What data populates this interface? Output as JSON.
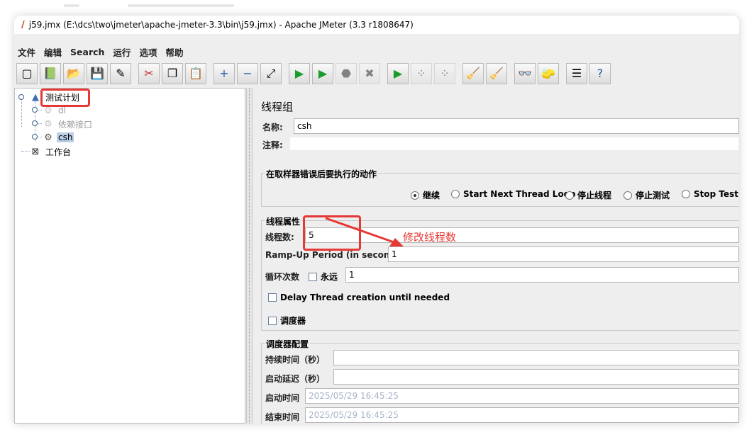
{
  "window": {
    "title": "j59.jmx (E:\\dcs\\two\\jmeter\\apache-jmeter-3.3\\bin\\j59.jmx) - Apache JMeter (3.3 r1808647)"
  },
  "menu": [
    "文件",
    "编辑",
    "Search",
    "运行",
    "选项",
    "帮助"
  ],
  "toolbar": [
    {
      "name": "new-icon",
      "glyph": "▢"
    },
    {
      "name": "templates-icon",
      "glyph": "📗"
    },
    {
      "name": "open-icon",
      "glyph": "📂"
    },
    {
      "name": "save-icon",
      "glyph": "💾"
    },
    {
      "name": "save-as-icon",
      "glyph": "✎"
    },
    {
      "name": "cut-icon",
      "glyph": "✂"
    },
    {
      "name": "copy-icon",
      "glyph": "❐"
    },
    {
      "name": "paste-icon",
      "glyph": "📋"
    },
    {
      "name": "expand-icon",
      "glyph": "+"
    },
    {
      "name": "collapse-icon",
      "glyph": "−"
    },
    {
      "name": "toggle-icon",
      "glyph": "⤢"
    },
    {
      "name": "start-icon",
      "glyph": "▶"
    },
    {
      "name": "start-no-pause-icon",
      "glyph": "▶"
    },
    {
      "name": "stop-icon",
      "glyph": "⬣"
    },
    {
      "name": "shutdown-icon",
      "glyph": "✖"
    },
    {
      "name": "remote-start-icon",
      "glyph": "▶"
    },
    {
      "name": "remote-stop-icon",
      "glyph": "⁘"
    },
    {
      "name": "remote-shutdown-icon",
      "glyph": "⁘"
    },
    {
      "name": "clear-icon",
      "glyph": "🧹"
    },
    {
      "name": "clear-all-icon",
      "glyph": "🧹"
    },
    {
      "name": "search-icon",
      "glyph": "👓"
    },
    {
      "name": "reset-search-icon",
      "glyph": "🧽"
    },
    {
      "name": "function-helper-icon",
      "glyph": "☰"
    },
    {
      "name": "help-icon",
      "glyph": "?"
    }
  ],
  "tree": {
    "root": "测试计划",
    "children": [
      "dl",
      "依赖接口",
      "csh"
    ],
    "workbench": "工作台"
  },
  "panel": {
    "heading": "线程组",
    "name_label": "名称:",
    "name_value": "csh",
    "comment_label": "注释:",
    "comment_value": "",
    "error_group_title": "在取样器错误后要执行的动作",
    "error_actions": [
      "继续",
      "Start Next Thread Loop",
      "停止线程",
      "停止测试",
      "Stop Test N"
    ],
    "thread_group_title": "线程属性",
    "threads_label": "线程数:",
    "threads_value": "5",
    "rampup_label": "Ramp-Up Period (in seconds):",
    "rampup_value": "1",
    "loop_label": "循环次数",
    "forever_label": "永远",
    "loop_value": "1",
    "delay_label": "Delay Thread creation until needed",
    "scheduler_label": "调度器",
    "sched_group_title": "调度器配置",
    "duration_label": "持续时间（秒）",
    "duration_value": "",
    "startup_delay_label": "启动延迟（秒）",
    "startup_delay_value": "",
    "start_time_label": "启动时间",
    "start_time_value": "2025/05/29 16:45:25",
    "end_time_label": "结束时间",
    "end_time_value": "2025/05/29 16:45:25"
  },
  "annotation": {
    "text": "修改线程数",
    "color": "#e53935"
  }
}
